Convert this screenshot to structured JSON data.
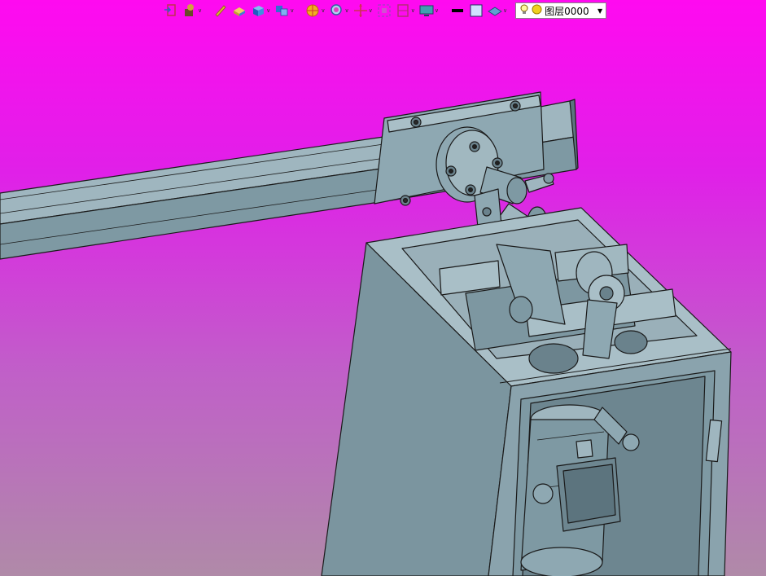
{
  "toolbar": {
    "layer": {
      "value": "图层0000"
    },
    "buttons": [
      {
        "icon": "exit-door-icon",
        "caret": false
      },
      {
        "icon": "coloring-tool-icon",
        "caret": true
      },
      {
        "icon": "pen-icon",
        "caret": false
      },
      {
        "icon": "box-icon",
        "caret": false
      },
      {
        "icon": "cube-icon",
        "caret": true
      },
      {
        "icon": "view-cubes-icon",
        "caret": true
      },
      {
        "icon": "section-disc-icon",
        "caret": true
      },
      {
        "icon": "zoom-icon",
        "caret": true
      },
      {
        "icon": "pan-cross-icon",
        "caret": true
      },
      {
        "icon": "fit-view-icon",
        "caret": false
      },
      {
        "icon": "frame-icon",
        "caret": true
      },
      {
        "icon": "display-monitor-icon",
        "caret": true
      },
      {
        "icon": "line-color-icon",
        "caret": false
      },
      {
        "icon": "fill-color-icon",
        "caret": false
      },
      {
        "icon": "surface-layer-icon",
        "caret": true
      }
    ]
  },
  "colors": {
    "model": "#7e99a3",
    "model_light": "#9fb6bf",
    "model_dark": "#5c747e",
    "edge": "#1a1a1a",
    "bg_top": "#ff0af0",
    "bg_bottom": "#b08aa8"
  }
}
